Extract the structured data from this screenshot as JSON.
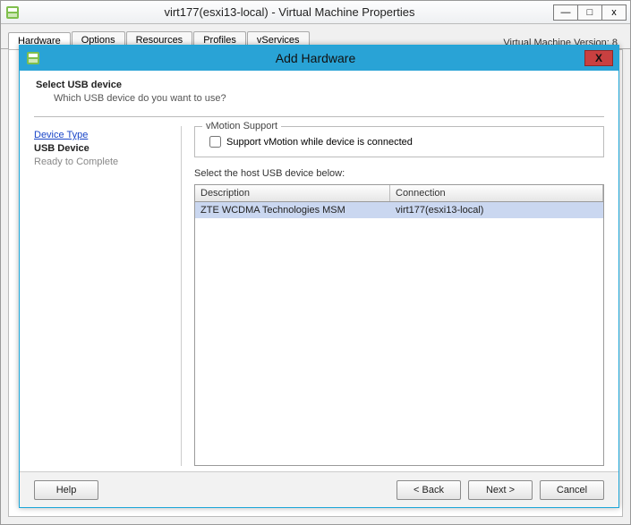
{
  "parent": {
    "title": "virt177(esxi13-local) - Virtual Machine Properties",
    "win_min": "—",
    "win_max": "□",
    "win_close": "x",
    "tabs": [
      "Hardware",
      "Options",
      "Resources",
      "Profiles",
      "vServices"
    ],
    "active_tab_index": 0,
    "version_label": "Virtual Machine Version: 8"
  },
  "modal": {
    "title": "Add Hardware",
    "close_glyph": "X",
    "heading": "Select USB device",
    "subheading": "Which USB device do you want to use?",
    "nav": {
      "step_link": "Device Type",
      "step_current": "USB Device",
      "step_disabled": "Ready to Complete"
    },
    "group": {
      "legend": "vMotion Support",
      "check_label": "Support vMotion while device is connected",
      "checked": false
    },
    "instruction": "Select the host USB device below:",
    "grid": {
      "col_description": "Description",
      "col_connection": "Connection",
      "rows": [
        {
          "description": "ZTE WCDMA Technologies MSM",
          "connection": "virt177(esxi13-local)"
        }
      ]
    },
    "buttons": {
      "help": "Help",
      "back": "< Back",
      "next": "Next >",
      "cancel": "Cancel"
    }
  }
}
